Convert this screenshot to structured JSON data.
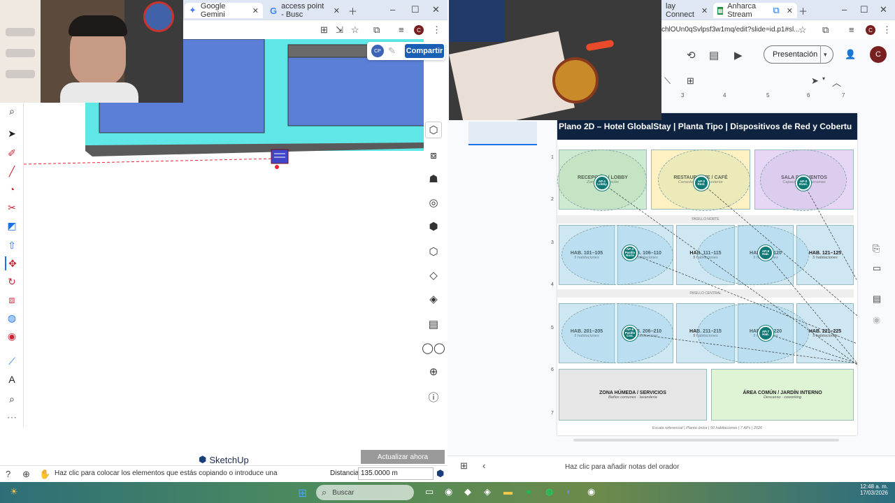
{
  "sketchup": {
    "tabs": [
      {
        "label": "Google Gemini",
        "icon": "gemini-icon"
      },
      {
        "label": "access point - Busc",
        "icon": "google-icon"
      }
    ],
    "share_label": "Compartir",
    "avatar_initials": "CP",
    "profile_initial": "C",
    "update_label": "Actualizar ahora",
    "brand": "SketchUp",
    "status_hint": "Haz clic para colocar los elementos que estás copiando o introduce una",
    "distance_label": "Distancia",
    "distance_value": "135.0000 m",
    "colors": {
      "floor_fill": "#5b7fd6",
      "wall_fill": "#5fe6e6",
      "accent": "#1a73e8"
    }
  },
  "slides": {
    "tabs": [
      {
        "label": "lay Connect"
      },
      {
        "label": "Anharca Stream",
        "icon": "sheets-icon"
      }
    ],
    "url": "chlOUn0qSvlpsf3w1mq/edit?slide=id.p1#sl...",
    "present_label": "Presentación",
    "profile_initial": "C",
    "ruler_ticks": [
      "3",
      "4",
      "5",
      "6",
      "7"
    ],
    "vruler_ticks": [
      "1",
      "2",
      "3",
      "4",
      "5",
      "6",
      "7"
    ],
    "title": "Plano 2D – Hotel GlobalStay  |  Planta Tipo  |  Dispositivos de Red y Cobertu",
    "zones": {
      "reception": {
        "title": "RECEPCIÓN / LOBBY",
        "sub": "Zona de recepción"
      },
      "restaurant": {
        "title": "RESTAURANTE / CAFÉ",
        "sub": "Comedor interior / exterior"
      },
      "events": {
        "title": "SALA DE EVENTOS",
        "sub": "Capacidad 100 personas"
      },
      "north_hall": "PASILLO NORTE",
      "central_hall": "PASILLO CENTRAL",
      "rooms_row1": [
        {
          "title": "HAB. 101–105",
          "sub": "5 habitaciones"
        },
        {
          "title": "HAB. 106–110",
          "sub": "5 habitaciones"
        },
        {
          "title": "HAB. 111–115",
          "sub": "5 habitaciones"
        },
        {
          "title": "HAB. 116–120",
          "sub": "5 habitaciones"
        },
        {
          "title": "HAB. 121–125",
          "sub": "5 habitaciones"
        }
      ],
      "rooms_row2": [
        {
          "title": "HAB. 201–205",
          "sub": "5 habitaciones"
        },
        {
          "title": "HAB. 206–210",
          "sub": "5 habitaciones"
        },
        {
          "title": "HAB. 211–215",
          "sub": "5 habitaciones"
        },
        {
          "title": "HAB. 216–220",
          "sub": "5 habitaciones"
        },
        {
          "title": "HAB. 221–225",
          "sub": "5 habitaciones"
        }
      ],
      "wet_zone": {
        "title": "ZONA HÚMEDA / SERVICIOS",
        "sub": "Baños comunes · lavanderia"
      },
      "garden": {
        "title": "ÁREA COMÚN / JARDÍN INTERNO",
        "sub": "Descanso · coworking"
      }
    },
    "access_points": [
      "AP-1 Lobby",
      "AP-2 Rest.",
      "AP-3 Even.",
      "AP-4 Pasillo Norte",
      "AP-5 Hab.",
      "AP-6 Pasillo Cen.",
      "AP-7 Hab."
    ],
    "footer": "Escala referencial  |  Planta única  |  50 habitaciones  |  7 APs  |  2026",
    "notes_placeholder": "Haz clic para añadir notas del orador",
    "colors": {
      "title_bar": "#0e2340",
      "ap": "#0f7a75",
      "reception": "#cdebd0",
      "restaurant": "#fff1c2",
      "events": "#e7d6f5",
      "rooms": "#cfe7f3",
      "wet": "#e6e6e6",
      "garden": "#dff3d5"
    }
  },
  "taskbar": {
    "search_placeholder": "Buscar",
    "time": "12:48 a. m.",
    "date": "17/03/2026"
  }
}
